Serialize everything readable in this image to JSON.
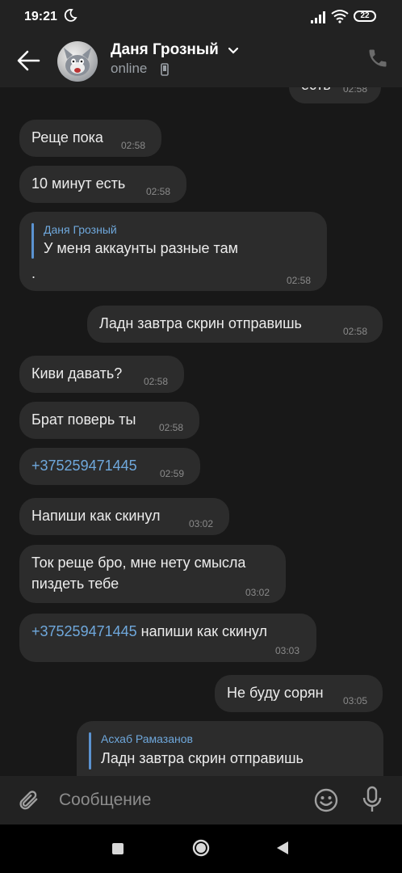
{
  "status_bar": {
    "time": "19:21",
    "battery": "22"
  },
  "header": {
    "name": "Даня Грозный",
    "status": "online"
  },
  "messages": [
    {
      "text": "есть",
      "time": "02:58"
    },
    {
      "text": "Реще пока",
      "time": "02:58"
    },
    {
      "text": "10 минут есть",
      "time": "02:58"
    },
    {
      "reply_name": "Даня Грозный",
      "reply_text": "У меня аккаунты разные там",
      "text": ".",
      "time": "02:58"
    },
    {
      "text": "Ладн завтра скрин отправишь",
      "time": "02:58"
    },
    {
      "text": "Киви давать?",
      "time": "02:58"
    },
    {
      "text": "Брат поверь ты",
      "time": "02:58"
    },
    {
      "text": "+375259471445",
      "time": "02:59"
    },
    {
      "text": "Напиши как скинул",
      "time": "03:02"
    },
    {
      "line1": "Ток реще бро, мне нету смысла",
      "line2": "пиздеть тебе",
      "time": "03:02"
    },
    {
      "link": "+375259471445",
      "text": " напиши как скинул",
      "time": "03:03"
    },
    {
      "text": "Не буду сорян",
      "time": "03:05"
    },
    {
      "reply_name": "Асхаб Рамазанов",
      "reply_text": "Ладн завтра скрин отправишь"
    }
  ],
  "input": {
    "placeholder": "Сообщение"
  },
  "colors": {
    "background": "#181818",
    "bubble": "#2c2c2c",
    "bar": "#222222",
    "link": "#6fa8dc"
  },
  "icons": [
    "moon-icon",
    "signal-icon",
    "wifi-icon",
    "battery-icon",
    "back-arrow-icon",
    "phone-icon",
    "call-icon",
    "chevron-down-icon",
    "attach-icon",
    "emoji-icon",
    "microphone-icon",
    "nav-square-icon",
    "nav-home-icon",
    "nav-back-icon"
  ]
}
